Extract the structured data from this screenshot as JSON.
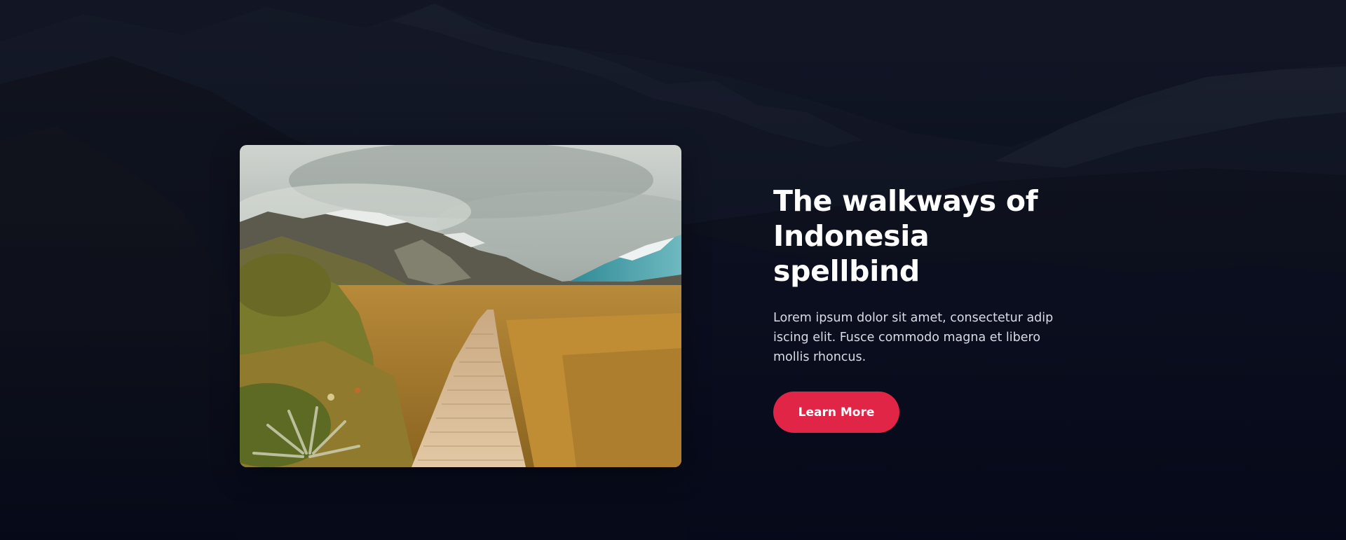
{
  "hero": {
    "image_alt": "wooden-boardwalk-through-golden-grassland-toward-snowy-mountains",
    "background_alt": "dark-mountain-landscape"
  },
  "content": {
    "title_line1": "The walkways of",
    "title_line2": "Indonesia spellbind",
    "description": "Lorem ipsum dolor sit amet, consectetur adip iscing elit. Fusce commodo magna et libero mollis rhoncus.",
    "cta_label": "Learn More"
  },
  "colors": {
    "background": "#070b1c",
    "cta": "#e02547",
    "text": "#ffffff",
    "muted_text": "#d9dce5"
  }
}
